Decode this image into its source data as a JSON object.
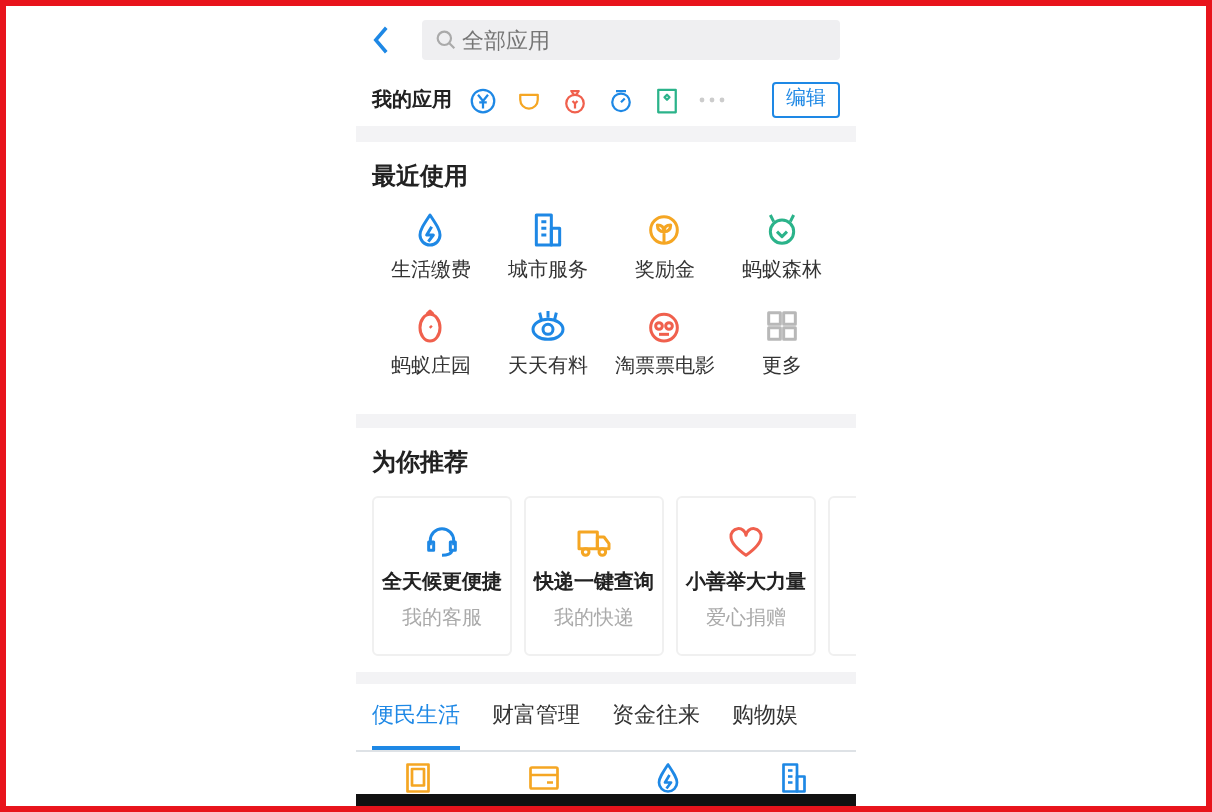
{
  "header": {
    "search": {
      "placeholder": "全部应用"
    }
  },
  "my_apps": {
    "label": "我的应用",
    "icons": [
      {
        "color": "#1e88e5"
      },
      {
        "color": "#f5a623"
      },
      {
        "color": "#f0604d"
      },
      {
        "color": "#1e88e5"
      },
      {
        "color": "#2bb38a"
      }
    ],
    "edit_button": "编辑"
  },
  "recent": {
    "title": "最近使用",
    "items": [
      {
        "label": "生活缴费",
        "kind": "drop",
        "color": "#1e88e5"
      },
      {
        "label": "城市服务",
        "kind": "building",
        "color": "#1e88e5"
      },
      {
        "label": "奖励金",
        "kind": "sprout",
        "color": "#f5a623"
      },
      {
        "label": "蚂蚁森林",
        "kind": "leaf",
        "color": "#2bb38a"
      },
      {
        "label": "蚂蚁庄园",
        "kind": "chick",
        "color": "#f0604d"
      },
      {
        "label": "天天有料",
        "kind": "eye",
        "color": "#1e88e5"
      },
      {
        "label": "淘票票电影",
        "kind": "face",
        "color": "#f0604d"
      },
      {
        "label": "更多",
        "kind": "grid",
        "color": "#b8b8b8"
      }
    ]
  },
  "recommend": {
    "title": "为你推荐",
    "cards": [
      {
        "title": "全天候更便捷",
        "subtitle": "我的客服",
        "kind": "headset",
        "color": "#1e88e5"
      },
      {
        "title": "快递一键查询",
        "subtitle": "我的快递",
        "kind": "truck",
        "color": "#f5a623"
      },
      {
        "title": "小善举大力量",
        "subtitle": "爱心捐赠",
        "kind": "heart",
        "color": "#f0604d"
      }
    ]
  },
  "category_tabs": [
    {
      "label": "便民生活",
      "selected": true
    },
    {
      "label": "财富管理",
      "selected": false
    },
    {
      "label": "资金往来",
      "selected": false
    },
    {
      "label": "购物娱",
      "selected": false
    }
  ],
  "category_icons": [
    {
      "kind": "tablet",
      "color": "#f5a623"
    },
    {
      "kind": "card",
      "color": "#f5a623"
    },
    {
      "kind": "drop",
      "color": "#1e88e5"
    },
    {
      "kind": "building",
      "color": "#1e88e5"
    }
  ]
}
